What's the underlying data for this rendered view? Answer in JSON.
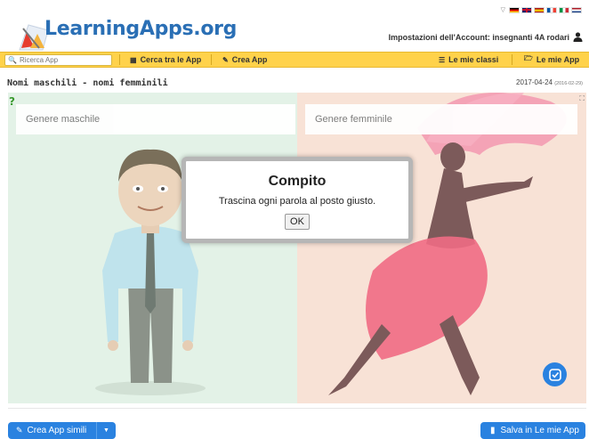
{
  "header": {
    "logo_text": "LearningApps.org",
    "account_text": "Impostazioni dell'Account: insegnanti 4A rodari",
    "account_icon": "user-icon",
    "flags": [
      {
        "name": "germany-flag",
        "colors": [
          "#000000",
          "#dd0000",
          "#ffce00"
        ]
      },
      {
        "name": "uk-flag",
        "colors": [
          "#012169",
          "#ffffff",
          "#c8102e"
        ]
      },
      {
        "name": "spain-flag",
        "colors": [
          "#aa151b",
          "#f1bf00",
          "#aa151b"
        ]
      },
      {
        "name": "france-flag",
        "colors": [
          "#0055a4",
          "#ffffff",
          "#ef4135"
        ]
      },
      {
        "name": "italy-flag",
        "colors": [
          "#009246",
          "#ffffff",
          "#ce2b37"
        ]
      },
      {
        "name": "netherlands-flag",
        "colors": [
          "#ae1c28",
          "#ffffff",
          "#21468b"
        ]
      }
    ]
  },
  "navbar": {
    "search_placeholder": "Ricerca App",
    "browse_label": "Cerca tra le App",
    "create_label": "Crea App",
    "classes_label": "Le mie classi",
    "myapps_label": "Le mie App"
  },
  "app": {
    "title": "Nomi maschili - nomi femminili",
    "date": "2017-04-24",
    "date_small": "(2016-02-29)",
    "category_left": "Genere maschile",
    "category_right": "Genere femminile"
  },
  "dialog": {
    "title": "Compito",
    "text": "Trascina ogni parola al posto giusto.",
    "ok_label": "OK"
  },
  "footer": {
    "similar_label": "Crea App simili",
    "save_label": "Salva in Le mie App"
  },
  "colors": {
    "brand_blue": "#2a82e0",
    "navbar_yellow": "#ffd24a",
    "left_panel": "#e3f2e7",
    "right_panel": "#f8e2d6"
  }
}
